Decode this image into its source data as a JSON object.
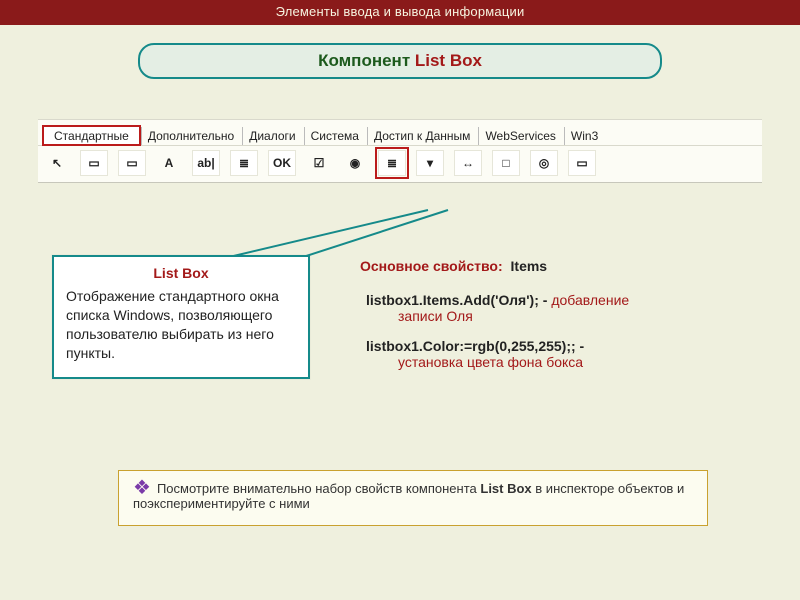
{
  "header": "Элементы ввода и вывода информации",
  "title": {
    "prefix": "Компонент ",
    "highlight": "List Box"
  },
  "tabs": [
    "Стандартные",
    "Дополнительно",
    "Диалоги",
    "Система",
    "Достип к Данным",
    "WebServices",
    "Win3"
  ],
  "active_tab_index": 0,
  "palette_icons": [
    {
      "name": "cursor-icon",
      "glyph": "↖"
    },
    {
      "name": "mainmenu-icon",
      "glyph": "▭"
    },
    {
      "name": "popup-icon",
      "glyph": "▭"
    },
    {
      "name": "label-icon",
      "glyph": "A"
    },
    {
      "name": "edit-icon",
      "glyph": "ab|"
    },
    {
      "name": "memo-icon",
      "glyph": "≣"
    },
    {
      "name": "button-icon",
      "glyph": "OK"
    },
    {
      "name": "checkbox-icon",
      "glyph": "☑"
    },
    {
      "name": "radio-icon",
      "glyph": "◉"
    },
    {
      "name": "listbox-icon",
      "glyph": "≣",
      "highlight": true
    },
    {
      "name": "combobox-icon",
      "glyph": "▾"
    },
    {
      "name": "scrollbar-icon",
      "glyph": "↔"
    },
    {
      "name": "groupbox-icon",
      "glyph": "□"
    },
    {
      "name": "radiogroup-icon",
      "glyph": "◎"
    },
    {
      "name": "panel-icon",
      "glyph": "▭"
    }
  ],
  "callout": {
    "title": "List Box",
    "body": "Отображение стандартного окна списка Windows, позволяющего пользователю выбирать из него пункты."
  },
  "right": {
    "prop_label": "Основное свойство:",
    "prop_value": "Items",
    "code1": "listbox1.Items.Add('Оля'); - ",
    "code1_comment_a": "добавление",
    "code1_comment_b": "записи Оля",
    "code2": "listbox1.Color:=rgb(0,255,255);; -",
    "code2_comment": "установка цвета фона бокса"
  },
  "note": {
    "mark": "❖",
    "text_a": "Посмотрите внимательно набор свойств компонента ",
    "strong": "List Box",
    "text_b": " в инспекторе объектов и поэкспериментируйте с ними"
  }
}
